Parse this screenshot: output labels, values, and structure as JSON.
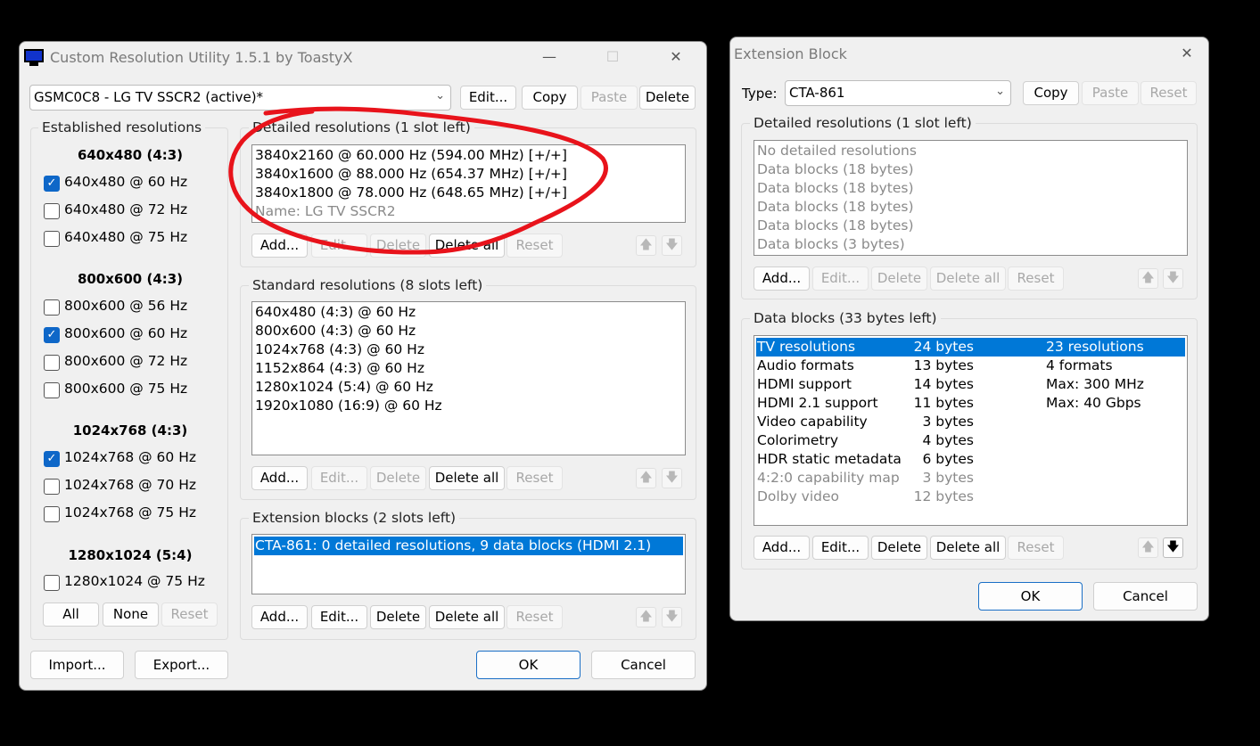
{
  "main": {
    "title": "Custom Resolution Utility 1.5.1 by ToastyX",
    "controls": {
      "minimize": "—",
      "maximize": "☐",
      "close": "✕"
    },
    "monitor_select": "GSMC0C8 - LG TV SSCR2 (active)*",
    "top_buttons": {
      "edit": "Edit...",
      "copy": "Copy",
      "paste": "Paste",
      "delete": "Delete"
    },
    "established": {
      "label": "Established resolutions",
      "groups": [
        {
          "header": "640x480 (4:3)",
          "items": [
            {
              "label": "640x480 @ 60 Hz",
              "checked": true
            },
            {
              "label": "640x480 @ 72 Hz",
              "checked": false
            },
            {
              "label": "640x480 @ 75 Hz",
              "checked": false
            }
          ]
        },
        {
          "header": "800x600 (4:3)",
          "items": [
            {
              "label": "800x600 @ 56 Hz",
              "checked": false
            },
            {
              "label": "800x600 @ 60 Hz",
              "checked": true
            },
            {
              "label": "800x600 @ 72 Hz",
              "checked": false
            },
            {
              "label": "800x600 @ 75 Hz",
              "checked": false
            }
          ]
        },
        {
          "header": "1024x768 (4:3)",
          "items": [
            {
              "label": "1024x768 @ 60 Hz",
              "checked": true
            },
            {
              "label": "1024x768 @ 70 Hz",
              "checked": false
            },
            {
              "label": "1024x768 @ 75 Hz",
              "checked": false
            }
          ]
        },
        {
          "header": "1280x1024 (5:4)",
          "items": [
            {
              "label": "1280x1024 @ 75 Hz",
              "checked": false
            }
          ]
        }
      ],
      "buttons": {
        "all": "All",
        "none": "None",
        "reset": "Reset"
      }
    },
    "detailed": {
      "label": "Detailed resolutions (1 slot left)",
      "items": [
        "3840x2160 @ 60.000 Hz (594.00 MHz) [+/+]",
        "3840x1600 @ 88.000 Hz (654.37 MHz) [+/+]",
        "3840x1800 @ 78.000 Hz (648.65 MHz) [+/+]"
      ],
      "name_line": "Name: LG TV SSCR2"
    },
    "standard": {
      "label": "Standard resolutions (8 slots left)",
      "items": [
        "640x480 (4:3) @ 60 Hz",
        "800x600 (4:3) @ 60 Hz",
        "1024x768 (4:3) @ 60 Hz",
        "1152x864 (4:3) @ 60 Hz",
        "1280x1024 (5:4) @ 60 Hz",
        "1920x1080 (16:9) @ 60 Hz"
      ]
    },
    "extension": {
      "label": "Extension blocks (2 slots left)",
      "items": [
        "CTA-861: 0 detailed resolutions, 9 data blocks (HDMI 2.1)"
      ]
    },
    "list_buttons": {
      "add": "Add...",
      "edit": "Edit...",
      "delete": "Delete",
      "delete_all": "Delete all",
      "reset": "Reset",
      "up": "🡅",
      "down": "🡇"
    },
    "bottom": {
      "import": "Import...",
      "export": "Export...",
      "ok": "OK",
      "cancel": "Cancel"
    },
    "annotation_color": "#e8131b"
  },
  "ext": {
    "title": "Extension Block",
    "close": "✕",
    "type_label": "Type:",
    "type_value": "CTA-861",
    "top_buttons": {
      "copy": "Copy",
      "paste": "Paste",
      "reset": "Reset"
    },
    "detailed": {
      "label": "Detailed resolutions (1 slot left)",
      "items": [
        "No detailed resolutions",
        "Data blocks (18 bytes)",
        "Data blocks (18 bytes)",
        "Data blocks (18 bytes)",
        "Data blocks (18 bytes)",
        "Data blocks (3 bytes)"
      ]
    },
    "data_blocks": {
      "label": "Data blocks (33 bytes left)",
      "rows": [
        {
          "name": "TV resolutions",
          "bytes": "24 bytes",
          "info": "23 resolutions",
          "selected": true,
          "disabled": false
        },
        {
          "name": "Audio formats",
          "bytes": "13 bytes",
          "info": "4 formats",
          "selected": false,
          "disabled": false
        },
        {
          "name": "HDMI support",
          "bytes": "14 bytes",
          "info": "Max: 300 MHz",
          "selected": false,
          "disabled": false
        },
        {
          "name": "HDMI 2.1 support",
          "bytes": "11 bytes",
          "info": "Max: 40 Gbps",
          "selected": false,
          "disabled": false
        },
        {
          "name": "Video capability",
          "bytes": "3 bytes",
          "info": "",
          "selected": false,
          "disabled": false
        },
        {
          "name": "Colorimetry",
          "bytes": "4 bytes",
          "info": "",
          "selected": false,
          "disabled": false
        },
        {
          "name": "HDR static metadata",
          "bytes": "6 bytes",
          "info": "",
          "selected": false,
          "disabled": false
        },
        {
          "name": "4:2:0 capability map",
          "bytes": "3 bytes",
          "info": "",
          "selected": false,
          "disabled": true
        },
        {
          "name": "Dolby video",
          "bytes": "12 bytes",
          "info": "",
          "selected": false,
          "disabled": true
        }
      ]
    },
    "list_buttons": {
      "add": "Add...",
      "edit": "Edit...",
      "delete": "Delete",
      "delete_all": "Delete all",
      "reset": "Reset",
      "up": "🡅",
      "down": "🡇"
    },
    "bottom": {
      "ok": "OK",
      "cancel": "Cancel"
    }
  }
}
